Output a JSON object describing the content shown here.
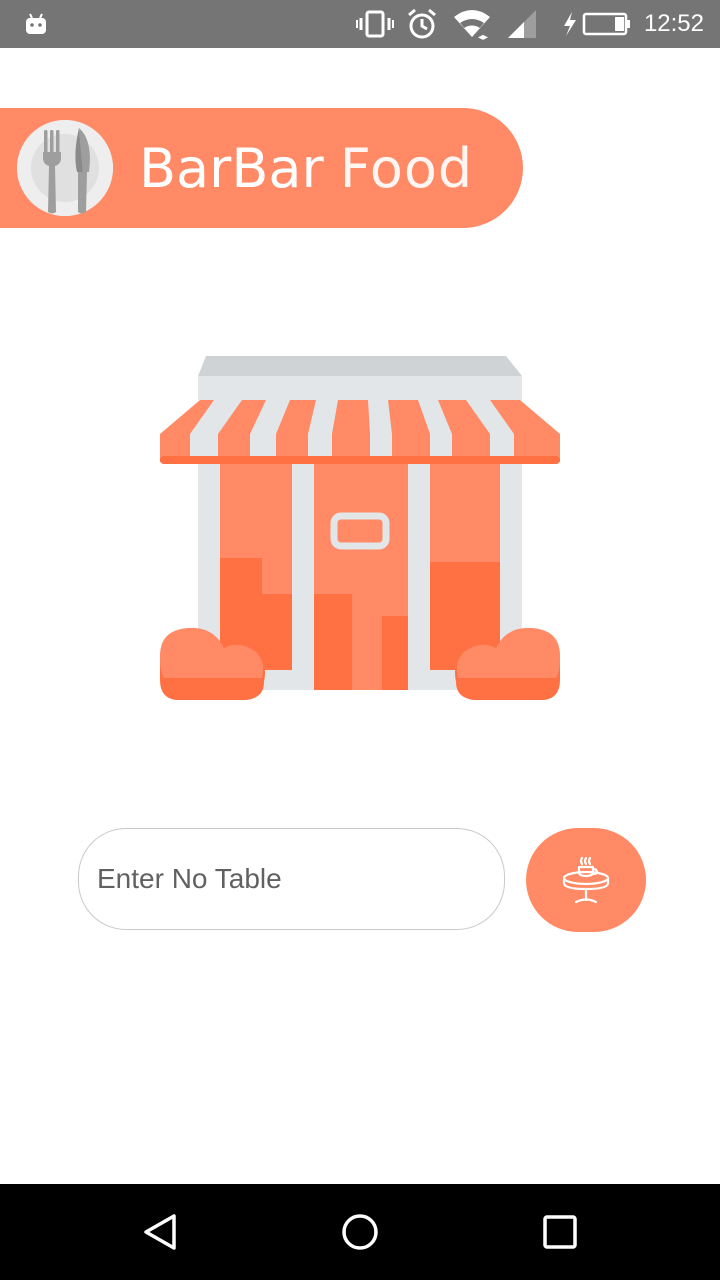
{
  "status_bar": {
    "time": "12:52",
    "icons": [
      "android-icon",
      "vibrate-icon",
      "alarm-icon",
      "wifi-icon",
      "signal-icon",
      "battery-charging-icon"
    ]
  },
  "header": {
    "brand_bold": "BarBar",
    "brand_light": "Food",
    "logo_icon": "fork-knife-plate-icon",
    "color": "#ff8a65"
  },
  "illustration": {
    "icon": "store-icon"
  },
  "table_form": {
    "placeholder": "Enter No Table",
    "value": "",
    "submit_icon": "table-coffee-icon"
  },
  "nav_bar": {
    "icons": [
      "back-icon",
      "home-icon",
      "recents-icon"
    ]
  },
  "colors": {
    "accent": "#ff8a65",
    "accent_dark": "#ff7043",
    "status_bar": "#757575",
    "nav_bar": "#000000"
  }
}
